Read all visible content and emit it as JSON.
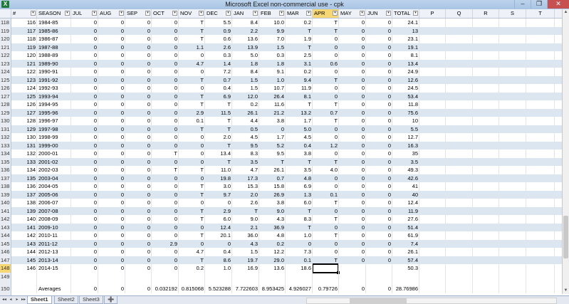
{
  "window": {
    "title": "Microsoft Excel non-commercial use - cpk",
    "app_icon": "excel-icon",
    "minimize": "–",
    "restore": "❐",
    "close": "✕"
  },
  "columns": [
    "#",
    "SEASON",
    "JUL",
    "AUG",
    "SEP",
    "OCT",
    "NOV",
    "DEC",
    "JAN",
    "FEB",
    "MAR",
    "APR",
    "MAY",
    "JUN",
    "TOTAL",
    "P",
    "Q",
    "R",
    "S",
    "T"
  ],
  "filter_columns": [
    "#",
    "SEASON",
    "JUL",
    "AUG",
    "SEP",
    "OCT",
    "NOV",
    "DEC",
    "JAN",
    "FEB",
    "MAR",
    "APR",
    "MAY",
    "JUN",
    "TOTAL"
  ],
  "highlighted_column": "APR",
  "filter_glyph": "▾",
  "rows": [
    {
      "r": "118",
      "n": "116",
      "s": "1984-85",
      "v": [
        "0",
        "0",
        "0",
        "0",
        "T",
        "5.5",
        "8.4",
        "10.0",
        "0.2",
        "T",
        "0",
        "0",
        "24.1"
      ]
    },
    {
      "r": "119",
      "n": "117",
      "s": "1985-86",
      "v": [
        "0",
        "0",
        "0",
        "0",
        "T",
        "0.9",
        "2.2",
        "9.9",
        "T",
        "T",
        "0",
        "0",
        "13"
      ]
    },
    {
      "r": "120",
      "n": "118",
      "s": "1986-87",
      "v": [
        "0",
        "0",
        "0",
        "0",
        "T",
        "0.6",
        "13.6",
        "7.0",
        "1.9",
        "0",
        "0",
        "0",
        "23.1"
      ]
    },
    {
      "r": "121",
      "n": "119",
      "s": "1987-88",
      "v": [
        "0",
        "0",
        "0",
        "0",
        "1.1",
        "2.6",
        "13.9",
        "1.5",
        "T",
        "0",
        "0",
        "0",
        "19.1"
      ]
    },
    {
      "r": "122",
      "n": "120",
      "s": "1988-89",
      "v": [
        "0",
        "0",
        "0",
        "0",
        "0",
        "0.3",
        "5.0",
        "0.3",
        "2.5",
        "0",
        "0",
        "0",
        "8.1"
      ]
    },
    {
      "r": "123",
      "n": "121",
      "s": "1989-90",
      "v": [
        "0",
        "0",
        "0",
        "0",
        "4.7",
        "1.4",
        "1.8",
        "1.8",
        "3.1",
        "0.6",
        "0",
        "0",
        "13.4"
      ]
    },
    {
      "r": "124",
      "n": "122",
      "s": "1990-91",
      "v": [
        "0",
        "0",
        "0",
        "0",
        "0",
        "7.2",
        "8.4",
        "9.1",
        "0.2",
        "0",
        "0",
        "0",
        "24.9"
      ]
    },
    {
      "r": "125",
      "n": "123",
      "s": "1991-92",
      "v": [
        "0",
        "0",
        "0",
        "0",
        "T",
        "0.7",
        "1.5",
        "1.0",
        "9.4",
        "T",
        "0",
        "0",
        "12.6"
      ]
    },
    {
      "r": "126",
      "n": "124",
      "s": "1992-93",
      "v": [
        "0",
        "0",
        "0",
        "0",
        "0",
        "0.4",
        "1.5",
        "10.7",
        "11.9",
        "0",
        "0",
        "0",
        "24.5"
      ]
    },
    {
      "r": "127",
      "n": "125",
      "s": "1993-94",
      "v": [
        "0",
        "0",
        "0",
        "0",
        "T",
        "6.9",
        "12.0",
        "26.4",
        "8.1",
        "0",
        "0",
        "0",
        "53.4"
      ]
    },
    {
      "r": "128",
      "n": "126",
      "s": "1994-95",
      "v": [
        "0",
        "0",
        "0",
        "0",
        "T",
        "T",
        "0.2",
        "11.6",
        "T",
        "T",
        "0",
        "0",
        "11.8"
      ]
    },
    {
      "r": "129",
      "n": "127",
      "s": "1995-96",
      "v": [
        "0",
        "0",
        "0",
        "0",
        "2.9",
        "11.5",
        "26.1",
        "21.2",
        "13.2",
        "0.7",
        "0",
        "0",
        "75.6"
      ]
    },
    {
      "r": "130",
      "n": "128",
      "s": "1996-97",
      "v": [
        "0",
        "0",
        "0",
        "0",
        "0.1",
        "T",
        "4.4",
        "3.8",
        "1.7",
        "T",
        "0",
        "0",
        "10"
      ]
    },
    {
      "r": "131",
      "n": "129",
      "s": "1997-98",
      "v": [
        "0",
        "0",
        "0",
        "0",
        "T",
        "T",
        "0.5",
        "0",
        "5.0",
        "0",
        "0",
        "0",
        "5.5"
      ]
    },
    {
      "r": "132",
      "n": "130",
      "s": "1998-99",
      "v": [
        "0",
        "0",
        "0",
        "0",
        "0",
        "2.0",
        "4.5",
        "1.7",
        "4.5",
        "0",
        "0",
        "0",
        "12.7"
      ]
    },
    {
      "r": "133",
      "n": "131",
      "s": "1999-00",
      "v": [
        "0",
        "0",
        "0",
        "0",
        "0",
        "T",
        "9.5",
        "5.2",
        "0.4",
        "1.2",
        "0",
        "0",
        "16.3"
      ]
    },
    {
      "r": "134",
      "n": "132",
      "s": "2000-01",
      "v": [
        "0",
        "0",
        "0",
        "T",
        "0",
        "13.4",
        "8.3",
        "9.5",
        "3.8",
        "0",
        "0",
        "0",
        "35"
      ]
    },
    {
      "r": "135",
      "n": "133",
      "s": "2001-02",
      "v": [
        "0",
        "0",
        "0",
        "0",
        "0",
        "T",
        "3.5",
        "T",
        "T",
        "T",
        "0",
        "0",
        "3.5"
      ]
    },
    {
      "r": "136",
      "n": "134",
      "s": "2002-03",
      "v": [
        "0",
        "0",
        "0",
        "T",
        "T",
        "11.0",
        "4.7",
        "26.1",
        "3.5",
        "4.0",
        "0",
        "0",
        "49.3"
      ]
    },
    {
      "r": "137",
      "n": "135",
      "s": "2003-04",
      "v": [
        "0",
        "0",
        "0",
        "0",
        "0",
        "19.8",
        "17.3",
        "0.7",
        "4.8",
        "0",
        "0",
        "0",
        "42.6"
      ]
    },
    {
      "r": "138",
      "n": "136",
      "s": "2004-05",
      "v": [
        "0",
        "0",
        "0",
        "0",
        "T",
        "3.0",
        "15.3",
        "15.8",
        "6.9",
        "0",
        "0",
        "0",
        "41"
      ]
    },
    {
      "r": "139",
      "n": "137",
      "s": "2005-06",
      "v": [
        "0",
        "0",
        "0",
        "0",
        "T",
        "9.7",
        "2.0",
        "26.9",
        "1.3",
        "0.1",
        "0",
        "0",
        "40"
      ]
    },
    {
      "r": "140",
      "n": "138",
      "s": "2006-07",
      "v": [
        "0",
        "0",
        "0",
        "0",
        "0",
        "0",
        "2.6",
        "3.8",
        "6.0",
        "T",
        "0",
        "0",
        "12.4"
      ]
    },
    {
      "r": "141",
      "n": "139",
      "s": "2007-08",
      "v": [
        "0",
        "0",
        "0",
        "0",
        "T",
        "2.9",
        "T",
        "9.0",
        "T",
        "0",
        "0",
        "0",
        "11.9"
      ]
    },
    {
      "r": "142",
      "n": "140",
      "s": "2008-09",
      "v": [
        "0",
        "0",
        "0",
        "0",
        "T",
        "6.0",
        "9.0",
        "4.3",
        "8.3",
        "T",
        "0",
        "0",
        "27.6"
      ]
    },
    {
      "r": "143",
      "n": "141",
      "s": "2009-10",
      "v": [
        "0",
        "0",
        "0",
        "0",
        "0",
        "12.4",
        "2.1",
        "36.9",
        "T",
        "0",
        "0",
        "0",
        "51.4"
      ]
    },
    {
      "r": "144",
      "n": "142",
      "s": "2010-11",
      "v": [
        "0",
        "0",
        "0",
        "0",
        "T",
        "20.1",
        "36.0",
        "4.8",
        "1.0",
        "T",
        "0",
        "0",
        "61.9"
      ]
    },
    {
      "r": "145",
      "n": "143",
      "s": "2011-12",
      "v": [
        "0",
        "0",
        "0",
        "2.9",
        "0",
        "0",
        "4.3",
        "0.2",
        "0",
        "0",
        "0",
        "0",
        "7.4"
      ]
    },
    {
      "r": "146",
      "n": "144",
      "s": "2012-13",
      "v": [
        "0",
        "0",
        "0",
        "0",
        "4.7",
        "0.4",
        "1.5",
        "12.2",
        "7.3",
        "0",
        "0",
        "0",
        "26.1"
      ]
    },
    {
      "r": "147",
      "n": "145",
      "s": "2013-14",
      "v": [
        "0",
        "0",
        "0",
        "0",
        "T",
        "8.6",
        "19.7",
        "29.0",
        "0.1",
        "T",
        "0",
        "0",
        "57.4"
      ]
    },
    {
      "r": "148",
      "n": "146",
      "s": "2014-15",
      "v": [
        "0",
        "0",
        "0",
        "0",
        "0.2",
        "1.0",
        "16.9",
        "13.6",
        "18.6",
        "",
        "",
        "",
        "50.3"
      ]
    }
  ],
  "blank_row": {
    "r": "149"
  },
  "averages_row": {
    "r": "150",
    "label": "Averages",
    "v": [
      "0",
      "0",
      "0",
      "0.032192",
      "0.815068",
      "5.523288",
      "7.722603",
      "8.953425",
      "4.926027",
      "0.79726",
      "0",
      "0",
      "28.76986"
    ]
  },
  "selected_row": "148",
  "sheets": [
    "Sheet1",
    "Sheet2",
    "Sheet3"
  ],
  "active_sheet": "Sheet1",
  "sheet_nav": [
    "◂◂",
    "◂",
    "▸",
    "▸▸"
  ],
  "new_sheet_icon": "➕"
}
